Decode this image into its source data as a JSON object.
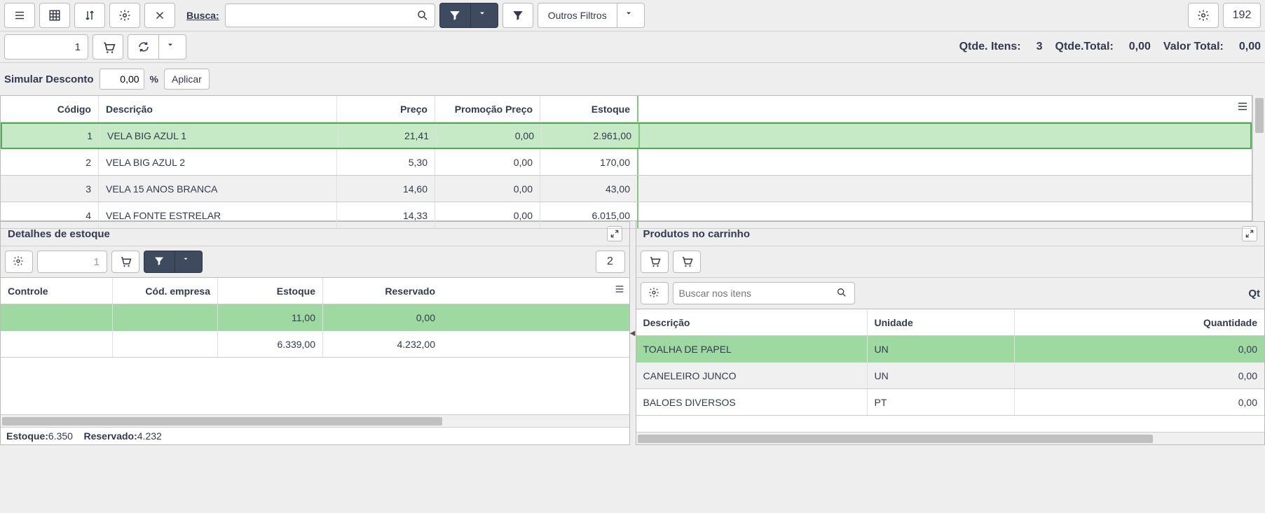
{
  "toolbar": {
    "search_label": "Busca:",
    "search_value": "",
    "other_filters": "Outros Filtros",
    "badge_count": "192"
  },
  "secondary": {
    "qty_input": "1",
    "totals": {
      "qtde_itens_label": "Qtde. Itens:",
      "qtde_itens_value": "3",
      "qtde_total_label": "Qtde.Total:",
      "qtde_total_value": "0,00",
      "valor_total_label": "Valor Total:",
      "valor_total_value": "0,00"
    }
  },
  "simulate": {
    "label": "Simular Desconto",
    "value": "0,00",
    "pct": "%",
    "apply": "Aplicar"
  },
  "maingrid": {
    "headers": {
      "codigo": "Código",
      "descricao": "Descrição",
      "preco": "Preço",
      "promo": "Promoção Preço",
      "estoque": "Estoque"
    },
    "rows": [
      {
        "codigo": "1",
        "descricao": "VELA BIG AZUL 1",
        "preco": "21,41",
        "promo": "0,00",
        "estoque": "2.961,00",
        "selected": true
      },
      {
        "codigo": "2",
        "descricao": "VELA BIG AZUL 2",
        "preco": "5,30",
        "promo": "0,00",
        "estoque": "170,00",
        "selected": false
      },
      {
        "codigo": "3",
        "descricao": "VELA 15 ANOS BRANCA",
        "preco": "14,60",
        "promo": "0,00",
        "estoque": "43,00",
        "selected": false
      },
      {
        "codigo": "4",
        "descricao": "VELA FONTE ESTRELAR",
        "preco": "14,33",
        "promo": "0,00",
        "estoque": "6.015,00",
        "selected": false
      }
    ]
  },
  "stock_panel": {
    "title": "Detalhes de estoque",
    "qty_input": "1",
    "badge": "2",
    "headers": {
      "controle": "Controle",
      "cod_empresa": "Cód. empresa",
      "estoque": "Estoque",
      "reservado": "Reservado"
    },
    "rows": [
      {
        "controle": "",
        "cod_empresa": "",
        "estoque": "11,00",
        "reservado": "0,00",
        "selected": true
      },
      {
        "controle": "",
        "cod_empresa": "",
        "estoque": "6.339,00",
        "reservado": "4.232,00",
        "selected": false
      }
    ],
    "footer": {
      "estoque_label": "Estoque:",
      "estoque_value": "6.350",
      "reservado_label": "Reservado:",
      "reservado_value": "4.232"
    }
  },
  "cart_panel": {
    "title": "Produtos no carrinho",
    "search_placeholder": "Buscar nos itens",
    "qt_trunc": "Qt",
    "headers": {
      "descricao": "Descrição",
      "unidade": "Unidade",
      "quantidade": "Quantidade"
    },
    "rows": [
      {
        "descricao": "TOALHA DE PAPEL",
        "unidade": "UN",
        "quantidade": "0,00",
        "selected": true
      },
      {
        "descricao": "CANELEIRO JUNCO",
        "unidade": "UN",
        "quantidade": "0,00",
        "selected": false
      },
      {
        "descricao": "BALOES DIVERSOS",
        "unidade": "PT",
        "quantidade": "0,00",
        "selected": false
      }
    ]
  }
}
